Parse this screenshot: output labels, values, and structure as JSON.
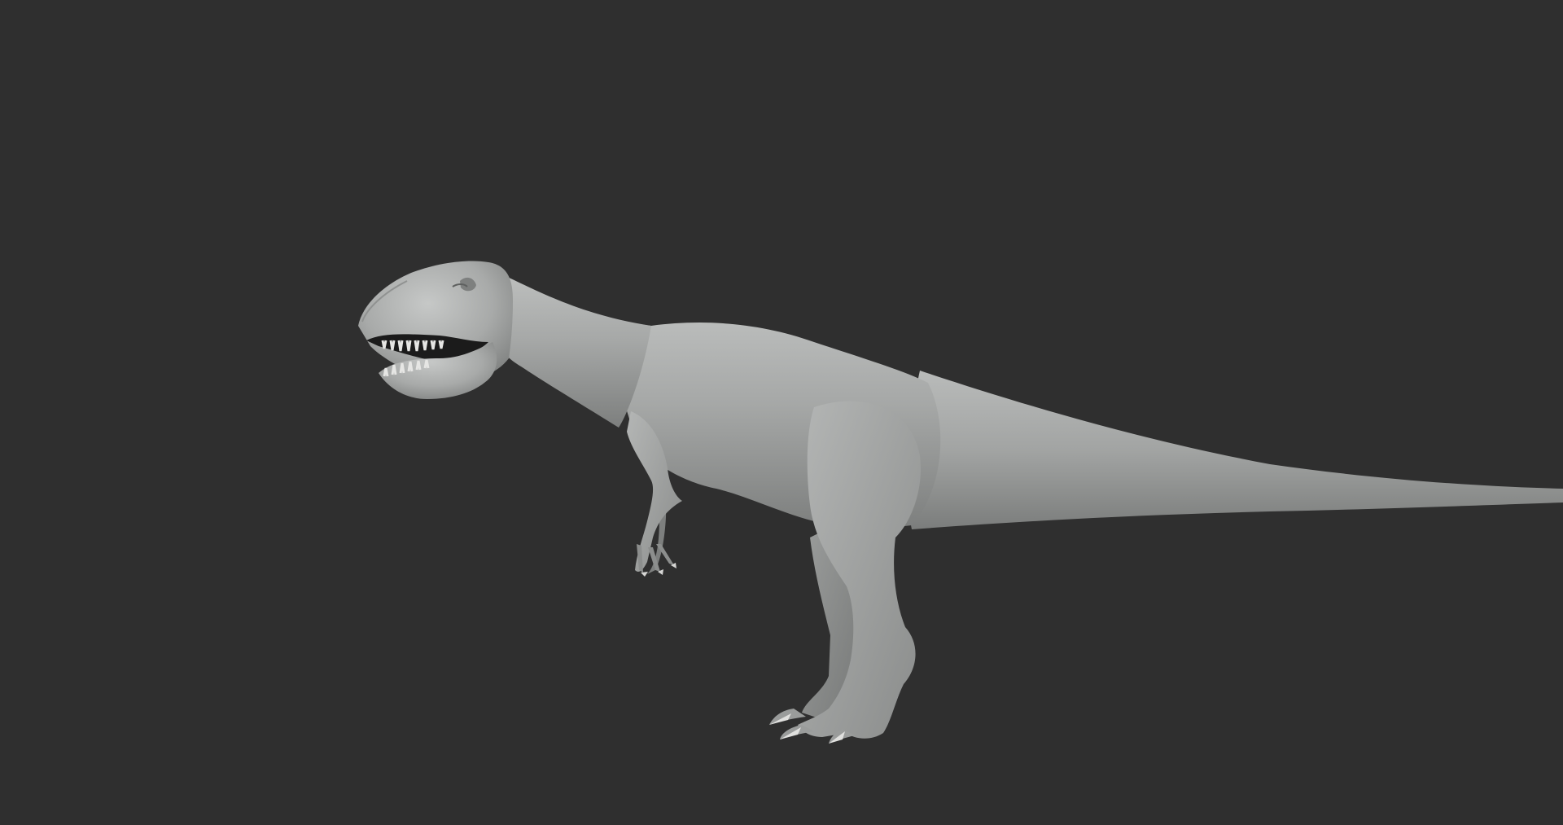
{
  "viewport": {
    "background_color": "#2f2f2f",
    "model_color": "#a3a5a4",
    "model_shadow_color": "#6f7170",
    "model_highlight_color": "#c3c5c4",
    "tooth_color": "#e6e6e4",
    "mouth_color": "#1b1b1b",
    "subject": "dinosaur-sculpt"
  }
}
